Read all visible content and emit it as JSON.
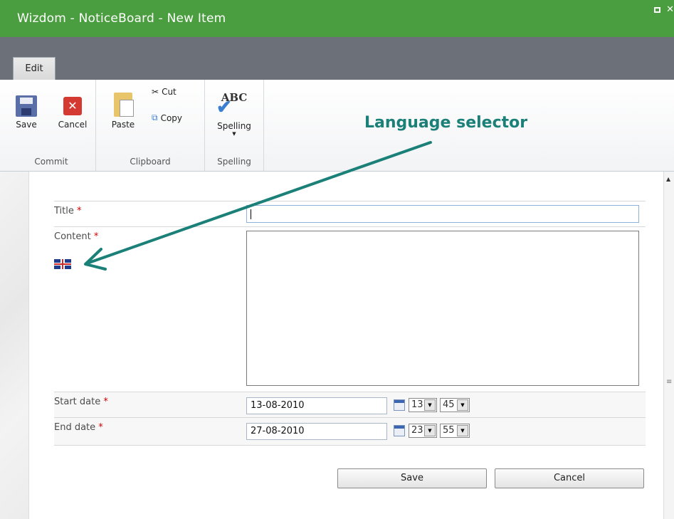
{
  "window": {
    "title": "Wizdom - NoticeBoard - New Item"
  },
  "tabs": [
    {
      "label": "Edit"
    }
  ],
  "ribbon": {
    "commit": {
      "label": "Commit",
      "save_label": "Save",
      "cancel_label": "Cancel"
    },
    "clipboard": {
      "label": "Clipboard",
      "paste_label": "Paste",
      "cut_label": "Cut",
      "copy_label": "Copy"
    },
    "spelling": {
      "label": "Spelling",
      "spelling_label": "Spelling",
      "abc": "ABC"
    }
  },
  "annotation": {
    "text": "Language selector",
    "color": "#1a8078"
  },
  "form": {
    "title": {
      "label": "Title",
      "required": "*",
      "value": ""
    },
    "content": {
      "label": "Content",
      "required": "*",
      "language_icon": "uk-flag-icon"
    },
    "start_date": {
      "label": "Start date",
      "required": "*",
      "date": "13-08-2010",
      "hour": "13:",
      "minute": "45"
    },
    "end_date": {
      "label": "End date",
      "required": "*",
      "date": "27-08-2010",
      "hour": "23:",
      "minute": "55"
    },
    "save_label": "Save",
    "cancel_label": "Cancel"
  },
  "colors": {
    "titlebar": "#4b9e3f",
    "band": "#6b7079",
    "required": "#d50000"
  }
}
